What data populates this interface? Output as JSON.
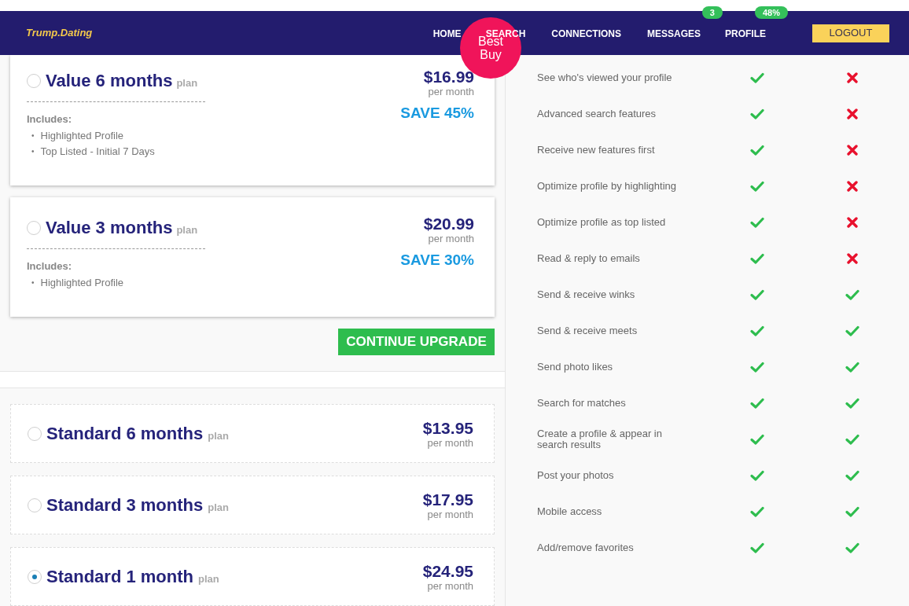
{
  "nav": {
    "logo": "Trump.*Dating*",
    "items": [
      {
        "label": "HOME"
      },
      {
        "label": "SEARCH"
      },
      {
        "label": "CONNECTIONS"
      },
      {
        "label": "MESSAGES",
        "badge": "3"
      },
      {
        "label": "PROFILE",
        "badge": "48%"
      }
    ],
    "logout": "LOGOUT"
  },
  "best_buy_badge": "Best Buy",
  "bullet": "•",
  "value_plans": [
    {
      "name": "Value 6 months",
      "suffix": "plan",
      "price": "$16.99",
      "period": "per month",
      "save": "SAVE 45%",
      "includes_label": "Includes:",
      "features": [
        "Highlighted Profile",
        "Top Listed - Initial 7 Days"
      ],
      "selected": false
    },
    {
      "name": "Value 3 months",
      "suffix": "plan",
      "price": "$20.99",
      "period": "per month",
      "save": "SAVE 30%",
      "includes_label": "Includes:",
      "features": [
        "Highlighted Profile"
      ],
      "selected": false
    }
  ],
  "continue_button": "CONTINUE UPGRADE",
  "standard_plans": [
    {
      "name": "Standard 6 months",
      "suffix": "plan",
      "price": "$13.95",
      "period": "per month",
      "selected": false
    },
    {
      "name": "Standard 3 months",
      "suffix": "plan",
      "price": "$17.95",
      "period": "per month",
      "selected": false
    },
    {
      "name": "Standard 1 month",
      "suffix": "plan",
      "price": "$24.95",
      "period": "per month",
      "selected": true
    }
  ],
  "comparison": [
    {
      "label": "See who's viewed your profile",
      "premium": true,
      "standard": false
    },
    {
      "label": "Advanced search features",
      "premium": true,
      "standard": false
    },
    {
      "label": "Receive new features first",
      "premium": true,
      "standard": false
    },
    {
      "label": "Optimize profile by highlighting",
      "premium": true,
      "standard": false
    },
    {
      "label": "Optimize profile as top listed",
      "premium": true,
      "standard": false
    },
    {
      "label": "Read & reply to emails",
      "premium": true,
      "standard": false
    },
    {
      "label": "Send & receive winks",
      "premium": true,
      "standard": true
    },
    {
      "label": "Send & receive meets",
      "premium": true,
      "standard": true
    },
    {
      "label": "Send photo likes",
      "premium": true,
      "standard": true
    },
    {
      "label": "Search for matches",
      "premium": true,
      "standard": true
    },
    {
      "label": "Create a profile & appear in search results",
      "premium": true,
      "standard": true
    },
    {
      "label": "Post your photos",
      "premium": true,
      "standard": true
    },
    {
      "label": "Mobile access",
      "premium": true,
      "standard": true
    },
    {
      "label": "Add/remove favorites",
      "premium": true,
      "standard": true
    }
  ]
}
